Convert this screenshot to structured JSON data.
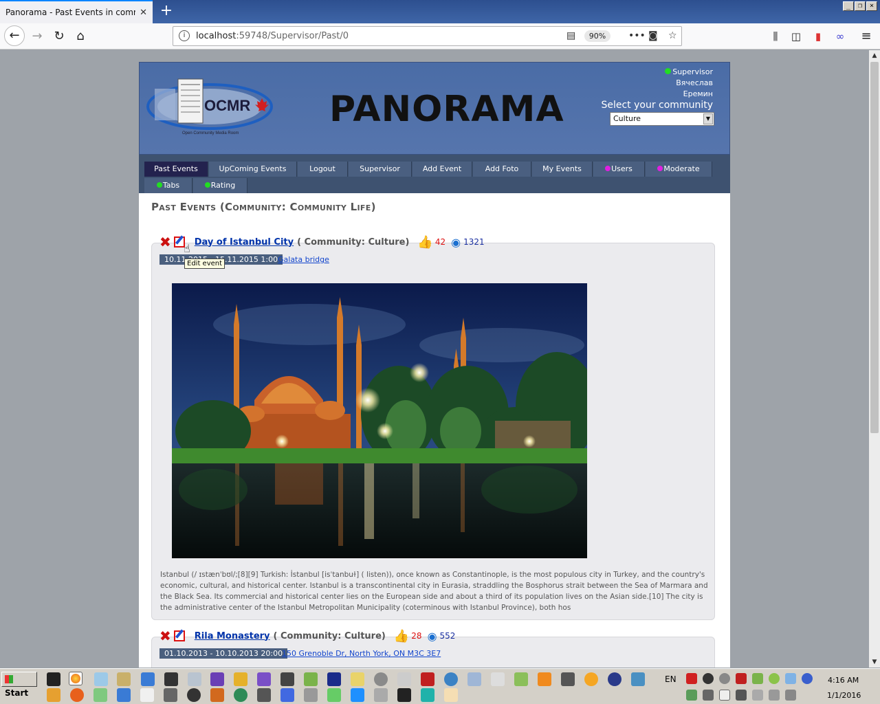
{
  "browser": {
    "tab_title": "Panorama - Past Events in community 0",
    "tab_close": "✕",
    "new_tab": "+",
    "url_host": "localhost",
    "url_path": ":59748/Supervisor/Past/0",
    "zoom": "90%"
  },
  "site": {
    "title": "PANORAMA",
    "logo_text": "OCMR",
    "logo_caption": "Open Community Media Room",
    "user": {
      "role": "Supervisor",
      "first_name": "Вячеслав",
      "last_name": "Еремин"
    },
    "community_label": "Select your community",
    "community_selected": "Culture"
  },
  "menu": {
    "items": [
      {
        "label": "Past Events"
      },
      {
        "label": "UpComing Events"
      },
      {
        "label": "Logout"
      },
      {
        "label": "Supervisor"
      },
      {
        "label": "Add Event"
      },
      {
        "label": "Add Foto"
      },
      {
        "label": "My Events"
      },
      {
        "label": "Users"
      },
      {
        "label": "Moderate"
      },
      {
        "label": "Tabs"
      },
      {
        "label": "Rating"
      }
    ]
  },
  "page_heading": "Past Events (Community: Community Life)",
  "events": [
    {
      "title": "Day of Istanbul City",
      "community": "( Community: Culture)",
      "likes": "42",
      "views": "1321",
      "dates": "10.11.2015 - 15.11.2015 1:00",
      "place": "Galata bridge",
      "description": "Istanbul (/ ɪstænˈbʊl/;[8][9] Turkish: İstanbul [isˈtanbuɫ] ( listen)), once known as Constantinople, is the most populous city in Turkey, and the country's economic, cultural, and historical center. Istanbul is a transcontinental city in Eurasia, straddling the Bosphorus strait between the Sea of Marmara and the Black Sea. Its commercial and historical center lies on the European side and about a third of its population lives on the Asian side.[10] The city is the administrative center of the Istanbul Metropolitan Municipality (coterminous with Istanbul Province), both hos"
    },
    {
      "title": "Rila Monastery",
      "community": "( Community: Culture)",
      "likes": "28",
      "views": "552",
      "dates": "01.10.2013 - 10.10.2013 20:00",
      "place": "150 Grenoble Dr, North York, ON M3C 3E7"
    }
  ],
  "tooltip": "Edit event",
  "taskbar": {
    "start": "Start",
    "lang": "EN",
    "time": "4:16 AM",
    "date": "1/1/2016"
  }
}
